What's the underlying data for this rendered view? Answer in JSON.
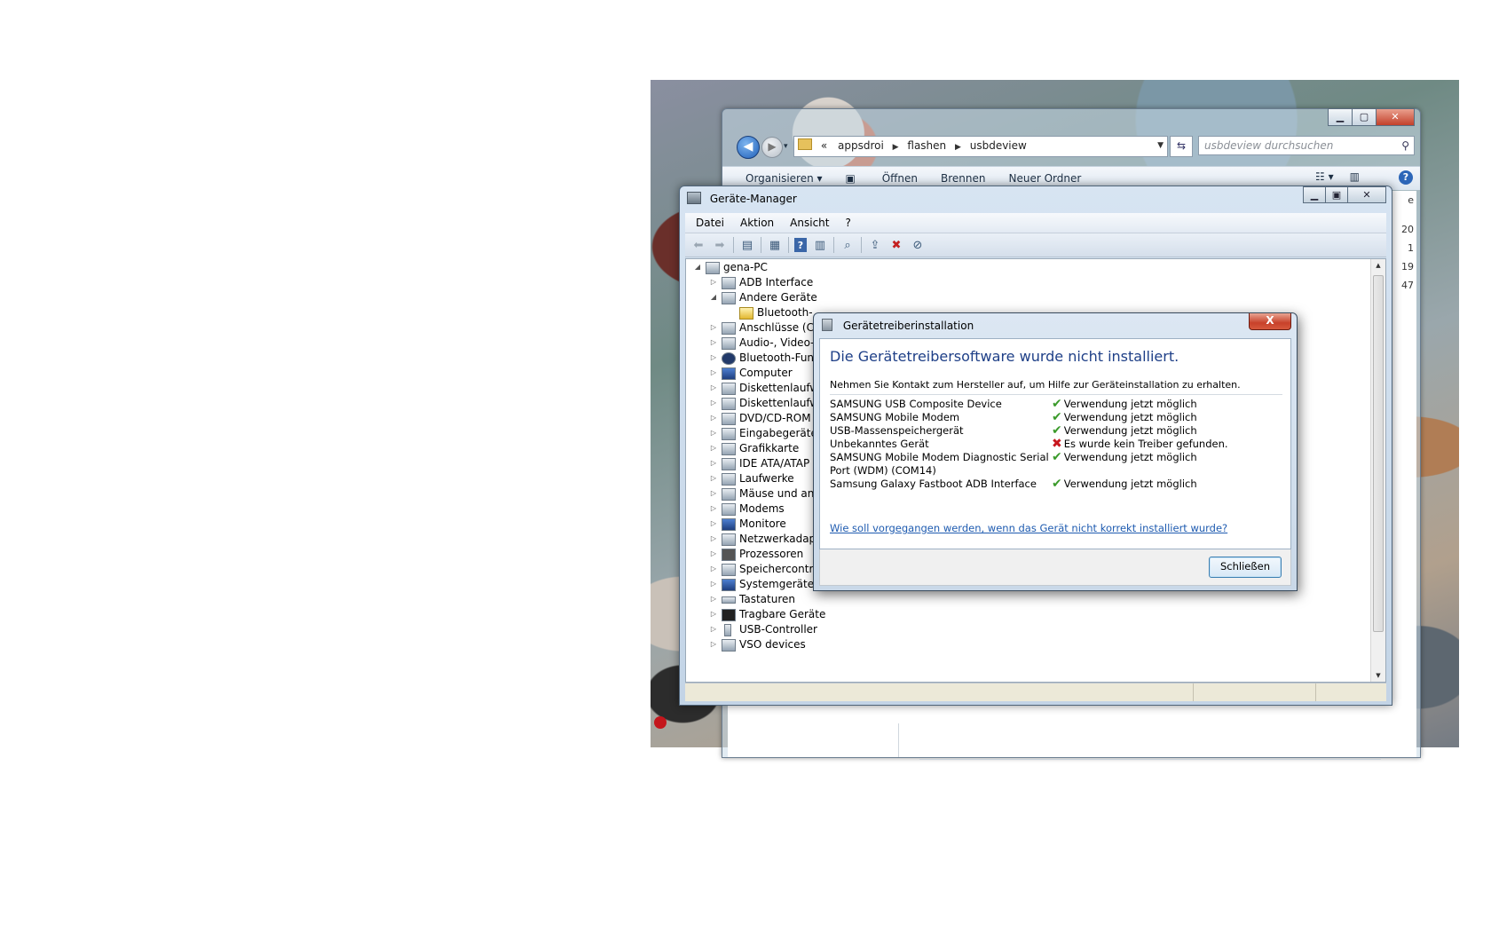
{
  "explorer": {
    "address": {
      "overflow": "«",
      "crumbs": [
        "appsdroi",
        "flashen",
        "usbdeview"
      ]
    },
    "search_placeholder": "usbdeview durchsuchen",
    "toolbar": [
      "Organisieren ▾",
      "Öffnen",
      "Brennen",
      "Neuer Ordner"
    ],
    "side_values": [
      "e",
      "20",
      "1",
      "19",
      "47"
    ]
  },
  "devmgr": {
    "title": "Geräte-Manager",
    "menu": [
      "Datei",
      "Aktion",
      "Ansicht",
      "?"
    ],
    "tree": {
      "root": "gena-PC",
      "items": [
        "ADB Interface",
        "Andere Geräte",
        "Bluetooth-",
        "Anschlüsse (CO",
        "Audio-, Video-",
        "Bluetooth-Fun",
        "Computer",
        "Diskettenlaufw",
        "Diskettenlaufw",
        "DVD/CD-ROM",
        "Eingabegeräte",
        "Grafikkarte",
        "IDE ATA/ATAP",
        "Laufwerke",
        "Mäuse und and",
        "Modems",
        "Monitore",
        "Netzwerkadapt",
        "Prozessoren",
        "Speichercontroller",
        "Systemgeräte",
        "Tastaturen",
        "Tragbare Geräte",
        "USB-Controller",
        "VSO devices"
      ]
    }
  },
  "dialog": {
    "title": "Gerätetreiberinstallation",
    "heading": "Die Gerätetreibersoftware wurde nicht installiert.",
    "info": "Nehmen Sie Kontakt zum Hersteller auf, um Hilfe zur Geräteinstallation zu erhalten.",
    "devices": [
      {
        "name": "SAMSUNG USB Composite Device",
        "status": "Verwendung jetzt möglich",
        "ok": true
      },
      {
        "name": "SAMSUNG Mobile Modem",
        "status": "Verwendung jetzt möglich",
        "ok": true
      },
      {
        "name": "USB-Massenspeichergerät",
        "status": "Verwendung jetzt möglich",
        "ok": true
      },
      {
        "name": "Unbekanntes Gerät",
        "status": "Es wurde kein Treiber gefunden.",
        "ok": false
      },
      {
        "name": "SAMSUNG Mobile Modem Diagnostic Serial Port (WDM) (COM14)",
        "status": "Verwendung jetzt möglich",
        "ok": true
      },
      {
        "name": "Samsung Galaxy Fastboot ADB Interface",
        "status": "Verwendung jetzt möglich",
        "ok": true
      }
    ],
    "help_link": "Wie soll vorgegangen werden, wenn das Gerät nicht korrekt installiert wurde?",
    "close_button": "Schließen",
    "close_x": "X"
  }
}
